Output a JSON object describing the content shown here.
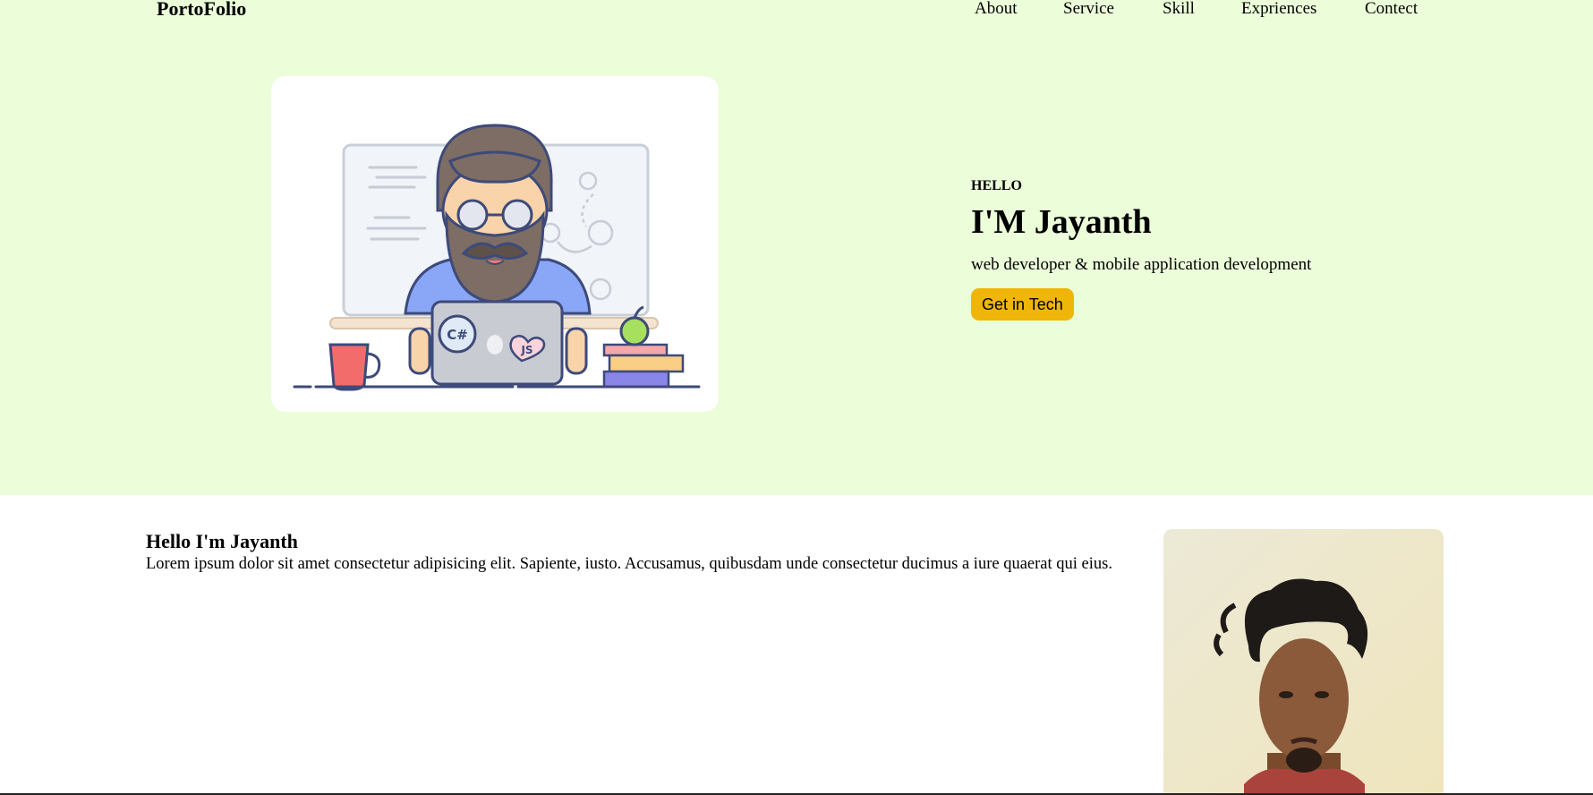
{
  "header": {
    "brand": "PortoFolio",
    "nav": [
      "About",
      "Service",
      "Skill",
      "Expriences",
      "Contect"
    ]
  },
  "hero": {
    "greeting": "HELLO",
    "name": "I'M Jayanth",
    "role": "web developer & mobile application development",
    "cta_label": "Get in Tech",
    "illustration": {
      "laptop_sticker_csharp": "C#",
      "laptop_sticker_js": "JS"
    }
  },
  "about": {
    "heading": "Hello I'm Jayanth",
    "body": "Lorem ipsum dolor sit amet consectetur adipisicing elit. Sapiente, iusto. Accusamus, quibusdam unde consectetur ducimus a iure quaerat qui eius."
  },
  "colors": {
    "hero_bg": "#ebfdd9",
    "cta_bg": "#efb508",
    "card_bg": "#ffffff"
  }
}
